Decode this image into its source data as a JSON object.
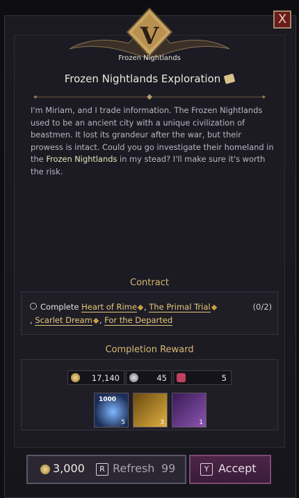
{
  "region": {
    "name": "Frozen Nightlands",
    "letter": "V"
  },
  "close_label": "X",
  "quest": {
    "title": "Frozen Nightlands Exploration",
    "desc_pre": "I'm Miriam, and I trade information. The Frozen Nightlands used to be an ancient city with a unique civilization of beastmen. It lost its grandeur after the war, but their prowess is intact. Could you go investigate their homeland in the ",
    "desc_hl": "Frozen Nightlands",
    "desc_post": " in my stead? I'll make sure it's worth the risk."
  },
  "contract": {
    "header": "Contract",
    "prefix": "Complete",
    "links": [
      "Heart of Rime",
      "The Primal Trial",
      "Scarlet Dream",
      "For the Departed"
    ],
    "progress": "(0/2)"
  },
  "reward": {
    "header": "Completion Reward",
    "resources": [
      {
        "icon": "gold-coin-icon",
        "value": "17,140"
      },
      {
        "icon": "silver-coin-icon",
        "value": "45"
      },
      {
        "icon": "heart-icon",
        "value": "5"
      }
    ],
    "items": [
      {
        "icon": "spirit-orb-icon",
        "tag": "1000",
        "qty": "5"
      },
      {
        "icon": "scroll-icon",
        "qty": "3"
      },
      {
        "icon": "treasure-chest-icon",
        "qty": "1"
      }
    ]
  },
  "footer": {
    "gold": "3,000",
    "refresh_key": "R",
    "refresh_label": "Refresh",
    "refresh_count": "99",
    "accept_key": "Y",
    "accept_label": "Accept"
  }
}
